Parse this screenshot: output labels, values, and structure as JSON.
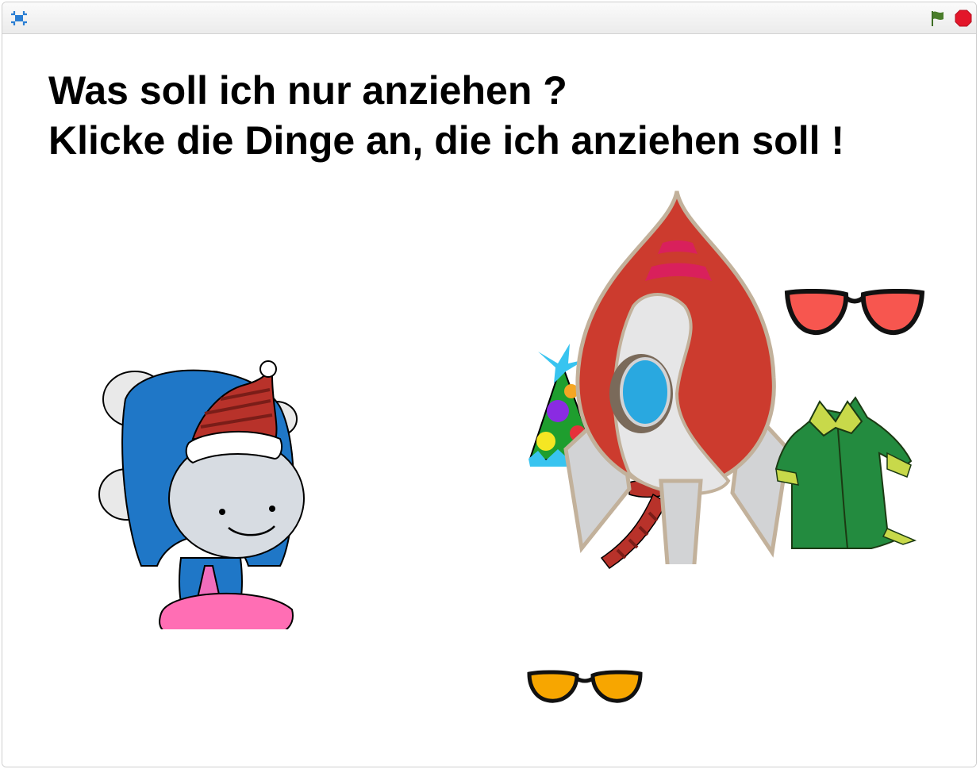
{
  "toolbar": {
    "fullscreen_icon": "fullscreen-icon",
    "green_flag_icon": "green-flag-icon",
    "stop_icon": "stop-icon",
    "flag_color": "#4a7d2b",
    "stop_color": "#e3162a"
  },
  "stage": {
    "prompt_line_1": "Was soll ich nur anziehen ?",
    "prompt_line_2": "Klicke die Dinge an, die ich anziehen soll !",
    "sprites": [
      "girl",
      "party-hat",
      "rocket",
      "scarf",
      "red-sunglasses",
      "green-coat",
      "orange-sunglasses"
    ]
  }
}
